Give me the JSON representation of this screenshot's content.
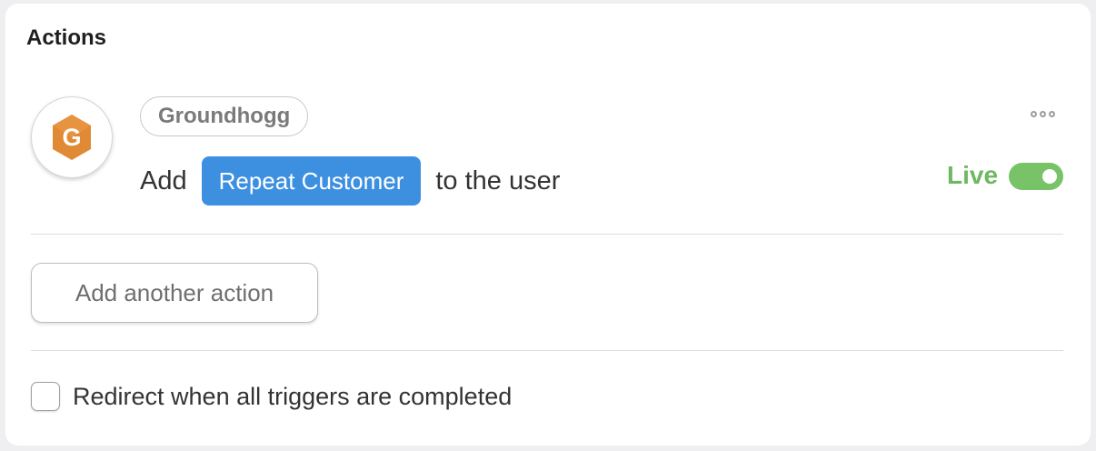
{
  "section": {
    "title": "Actions"
  },
  "action": {
    "provider": "Groundhogg",
    "provider_icon": "groundhogg-hexagon-logo",
    "verb": "Add",
    "tag": "Repeat Customer",
    "suffix": "to the user",
    "status": "Live",
    "enabled": true,
    "menu_icon": "more-horizontal-icon"
  },
  "buttons": {
    "add_action": "Add another action"
  },
  "options": {
    "redirect_label": "Redirect when all triggers are completed",
    "redirect_checked": false
  },
  "colors": {
    "accent_blue": "#3d8fe0",
    "live_green": "#6fb863",
    "toggle_green": "#78c267",
    "logo_orange": "#e08a35"
  }
}
